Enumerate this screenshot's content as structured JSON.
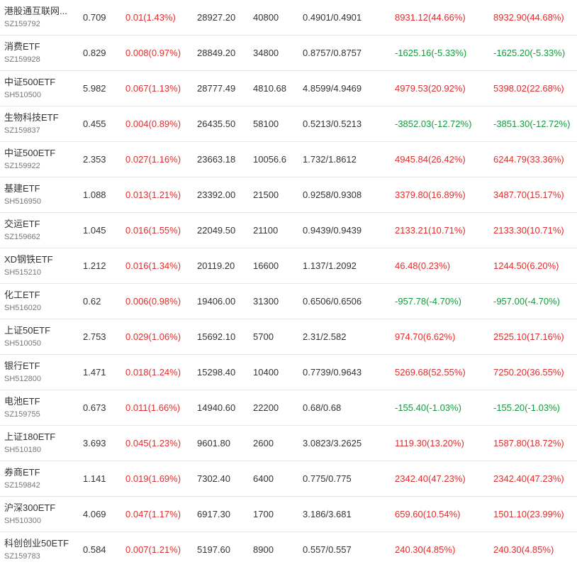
{
  "colors": {
    "gain": "#e02d2d",
    "loss": "#129b3a",
    "text": "#333333",
    "code": "#777777",
    "divider": "#e8e8e8"
  },
  "rows": [
    {
      "name": "港股通互联网...",
      "code": "SZ159792",
      "price": "0.709",
      "change": "0.01(1.43%)",
      "change_dir": "up",
      "value": "28927.20",
      "shares": "40800",
      "cost": "0.4901/0.4901",
      "pnl_a": "8931.12(44.66%)",
      "pnl_a_dir": "up",
      "pnl_b": "8932.90(44.68%)",
      "pnl_b_dir": "up"
    },
    {
      "name": "消费ETF",
      "code": "SZ159928",
      "price": "0.829",
      "change": "0.008(0.97%)",
      "change_dir": "up",
      "value": "28849.20",
      "shares": "34800",
      "cost": "0.8757/0.8757",
      "pnl_a": "-1625.16(-5.33%)",
      "pnl_a_dir": "down",
      "pnl_b": "-1625.20(-5.33%)",
      "pnl_b_dir": "down"
    },
    {
      "name": "中证500ETF",
      "code": "SH510500",
      "price": "5.982",
      "change": "0.067(1.13%)",
      "change_dir": "up",
      "value": "28777.49",
      "shares": "4810.68",
      "cost": "4.8599/4.9469",
      "pnl_a": "4979.53(20.92%)",
      "pnl_a_dir": "up",
      "pnl_b": "5398.02(22.68%)",
      "pnl_b_dir": "up"
    },
    {
      "name": "生物科技ETF",
      "code": "SZ159837",
      "price": "0.455",
      "change": "0.004(0.89%)",
      "change_dir": "up",
      "value": "26435.50",
      "shares": "58100",
      "cost": "0.5213/0.5213",
      "pnl_a": "-3852.03(-12.72%)",
      "pnl_a_dir": "down",
      "pnl_b": "-3851.30(-12.72%)",
      "pnl_b_dir": "down"
    },
    {
      "name": "中证500ETF",
      "code": "SZ159922",
      "price": "2.353",
      "change": "0.027(1.16%)",
      "change_dir": "up",
      "value": "23663.18",
      "shares": "10056.6",
      "cost": "1.732/1.8612",
      "pnl_a": "4945.84(26.42%)",
      "pnl_a_dir": "up",
      "pnl_b": "6244.79(33.36%)",
      "pnl_b_dir": "up"
    },
    {
      "name": "基建ETF",
      "code": "SH516950",
      "price": "1.088",
      "change": "0.013(1.21%)",
      "change_dir": "up",
      "value": "23392.00",
      "shares": "21500",
      "cost": "0.9258/0.9308",
      "pnl_a": "3379.80(16.89%)",
      "pnl_a_dir": "up",
      "pnl_b": "3487.70(15.17%)",
      "pnl_b_dir": "up"
    },
    {
      "name": "交运ETF",
      "code": "SZ159662",
      "price": "1.045",
      "change": "0.016(1.55%)",
      "change_dir": "up",
      "value": "22049.50",
      "shares": "21100",
      "cost": "0.9439/0.9439",
      "pnl_a": "2133.21(10.71%)",
      "pnl_a_dir": "up",
      "pnl_b": "2133.30(10.71%)",
      "pnl_b_dir": "up"
    },
    {
      "name": "XD钢铁ETF",
      "code": "SH515210",
      "price": "1.212",
      "change": "0.016(1.34%)",
      "change_dir": "up",
      "value": "20119.20",
      "shares": "16600",
      "cost": "1.137/1.2092",
      "pnl_a": "46.48(0.23%)",
      "pnl_a_dir": "up",
      "pnl_b": "1244.50(6.20%)",
      "pnl_b_dir": "up"
    },
    {
      "name": "化工ETF",
      "code": "SH516020",
      "price": "0.62",
      "change": "0.006(0.98%)",
      "change_dir": "up",
      "value": "19406.00",
      "shares": "31300",
      "cost": "0.6506/0.6506",
      "pnl_a": "-957.78(-4.70%)",
      "pnl_a_dir": "down",
      "pnl_b": "-957.00(-4.70%)",
      "pnl_b_dir": "down"
    },
    {
      "name": "上证50ETF",
      "code": "SH510050",
      "price": "2.753",
      "change": "0.029(1.06%)",
      "change_dir": "up",
      "value": "15692.10",
      "shares": "5700",
      "cost": "2.31/2.582",
      "pnl_a": "974.70(6.62%)",
      "pnl_a_dir": "up",
      "pnl_b": "2525.10(17.16%)",
      "pnl_b_dir": "up"
    },
    {
      "name": "银行ETF",
      "code": "SH512800",
      "price": "1.471",
      "change": "0.018(1.24%)",
      "change_dir": "up",
      "value": "15298.40",
      "shares": "10400",
      "cost": "0.7739/0.9643",
      "pnl_a": "5269.68(52.55%)",
      "pnl_a_dir": "up",
      "pnl_b": "7250.20(36.55%)",
      "pnl_b_dir": "up"
    },
    {
      "name": "电池ETF",
      "code": "SZ159755",
      "price": "0.673",
      "change": "0.011(1.66%)",
      "change_dir": "up",
      "value": "14940.60",
      "shares": "22200",
      "cost": "0.68/0.68",
      "pnl_a": "-155.40(-1.03%)",
      "pnl_a_dir": "down",
      "pnl_b": "-155.20(-1.03%)",
      "pnl_b_dir": "down"
    },
    {
      "name": "上证180ETF",
      "code": "SH510180",
      "price": "3.693",
      "change": "0.045(1.23%)",
      "change_dir": "up",
      "value": "9601.80",
      "shares": "2600",
      "cost": "3.0823/3.2625",
      "pnl_a": "1119.30(13.20%)",
      "pnl_a_dir": "up",
      "pnl_b": "1587.80(18.72%)",
      "pnl_b_dir": "up"
    },
    {
      "name": "券商ETF",
      "code": "SZ159842",
      "price": "1.141",
      "change": "0.019(1.69%)",
      "change_dir": "up",
      "value": "7302.40",
      "shares": "6400",
      "cost": "0.775/0.775",
      "pnl_a": "2342.40(47.23%)",
      "pnl_a_dir": "up",
      "pnl_b": "2342.40(47.23%)",
      "pnl_b_dir": "up"
    },
    {
      "name": "沪深300ETF",
      "code": "SH510300",
      "price": "4.069",
      "change": "0.047(1.17%)",
      "change_dir": "up",
      "value": "6917.30",
      "shares": "1700",
      "cost": "3.186/3.681",
      "pnl_a": "659.60(10.54%)",
      "pnl_a_dir": "up",
      "pnl_b": "1501.10(23.99%)",
      "pnl_b_dir": "up"
    },
    {
      "name": "科创创业50ETF",
      "code": "SZ159783",
      "price": "0.584",
      "change": "0.007(1.21%)",
      "change_dir": "up",
      "value": "5197.60",
      "shares": "8900",
      "cost": "0.557/0.557",
      "pnl_a": "240.30(4.85%)",
      "pnl_a_dir": "up",
      "pnl_b": "240.30(4.85%)",
      "pnl_b_dir": "up"
    }
  ]
}
